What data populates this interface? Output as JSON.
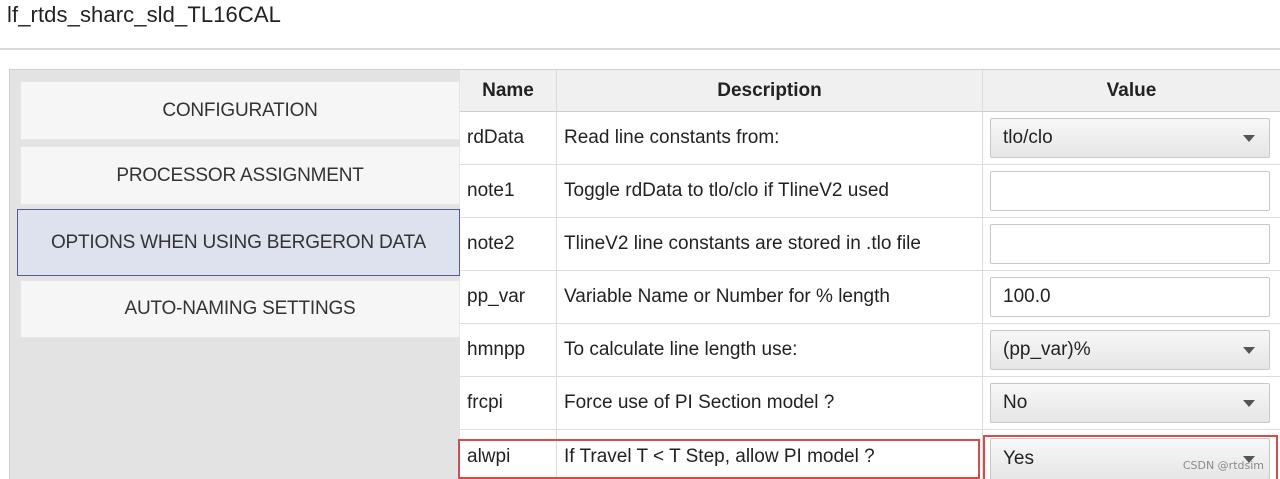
{
  "window": {
    "title": "lf_rtds_sharc_sld_TL16CAL"
  },
  "sidebar": {
    "items": [
      {
        "label": "CONFIGURATION",
        "active": false
      },
      {
        "label": "PROCESSOR ASSIGNMENT",
        "active": false
      },
      {
        "label": "OPTIONS WHEN USING BERGERON DATA",
        "active": true
      },
      {
        "label": "AUTO-NAMING SETTINGS",
        "active": false
      }
    ]
  },
  "table": {
    "headers": {
      "name": "Name",
      "description": "Description",
      "value": "Value"
    },
    "rows": [
      {
        "name": "rdData",
        "description": "Read line constants from:",
        "value": "tlo/clo",
        "control": "select"
      },
      {
        "name": "note1",
        "description": "Toggle rdData to tlo/clo if TlineV2 used",
        "value": "",
        "control": "text"
      },
      {
        "name": "note2",
        "description": "TlineV2 line constants are stored in .tlo file",
        "value": "",
        "control": "text"
      },
      {
        "name": "pp_var",
        "description": "Variable Name or Number for % length",
        "value": "100.0",
        "control": "text"
      },
      {
        "name": "hmnpp",
        "description": "To calculate line length use:",
        "value": "(pp_var)%",
        "control": "select"
      },
      {
        "name": "frcpi",
        "description": "Force use of PI Section model ?",
        "value": "No",
        "control": "select"
      },
      {
        "name": "alwpi",
        "description": "If Travel T < T Step, allow PI model ?",
        "value": "Yes",
        "control": "select",
        "highlighted": true
      }
    ]
  },
  "watermark": "CSDN @rtdsim",
  "colors": {
    "highlight": "#d94a4a",
    "active_nav_bg": "#dde2ee",
    "active_nav_border": "#4f5e8a"
  }
}
